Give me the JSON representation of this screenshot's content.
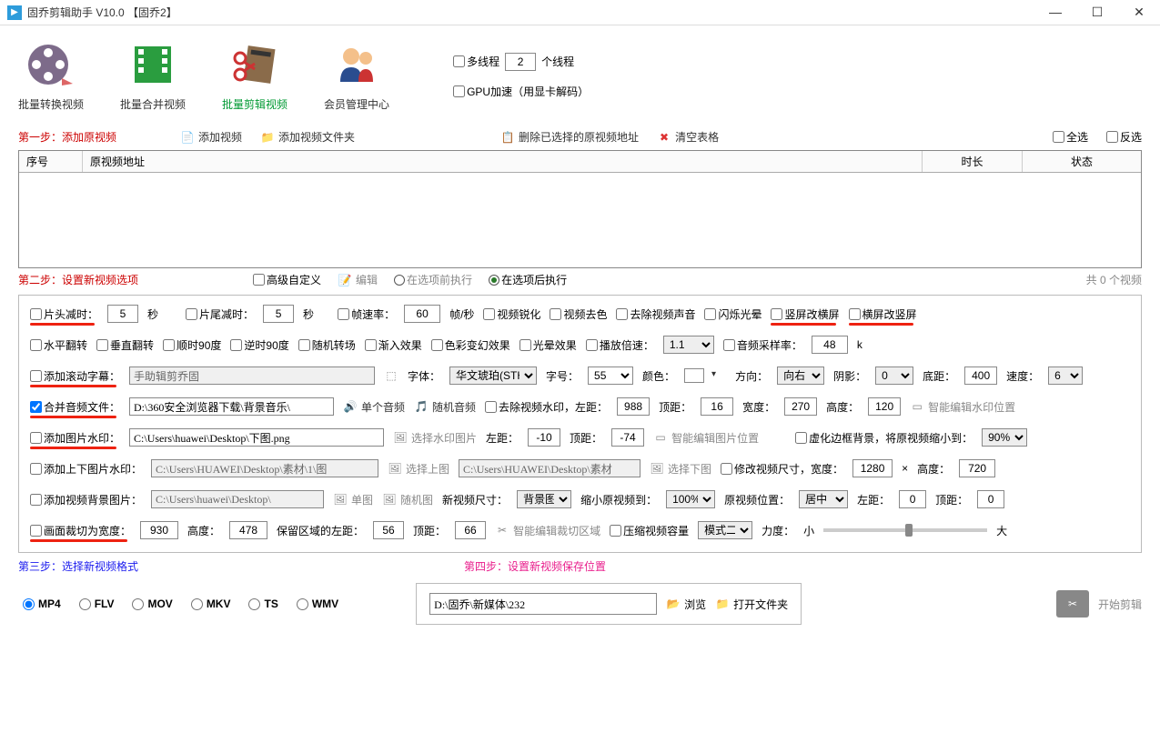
{
  "title": "固乔剪辑助手 V10.0  【固乔2】",
  "toolbar": {
    "t1": "批量转换视频",
    "t2": "批量合并视频",
    "t3": "批量剪辑视频",
    "t4": "会员管理中心",
    "multithread": "多线程",
    "threads": "2",
    "threads_unit": "个线程",
    "gpu": "GPU加速（用显卡解码）"
  },
  "step1": {
    "label": "第一步：添加原视频",
    "add_video": "添加视频",
    "add_folder": "添加视频文件夹",
    "delete_sel": "删除已选择的原视频地址",
    "clear": "清空表格",
    "select_all": "全选",
    "invert": "反选"
  },
  "table": {
    "c1": "序号",
    "c2": "原视频地址",
    "c3": "时长",
    "c4": "状态"
  },
  "step2": {
    "label": "第二步：设置新视频选项",
    "advanced": "高级自定义",
    "edit": "编辑",
    "before": "在选项前执行",
    "after": "在选项后执行",
    "count": "共  0  个视频"
  },
  "opts": {
    "head_trim": "片头减时：",
    "head_val": "5",
    "sec": "秒",
    "tail_trim": "片尾减时：",
    "tail_val": "5",
    "fps": "帧速率：",
    "fps_val": "60",
    "fps_unit": "帧/秒",
    "sharpen": "视频锐化",
    "decolor": "视频去色",
    "mute": "去除视频声音",
    "flash": "闪烁光晕",
    "v2h": "竖屏改横屏",
    "h2v": "横屏改竖屏",
    "hflip": "水平翻转",
    "vflip": "垂直翻转",
    "cw90": "顺时90度",
    "ccw90": "逆时90度",
    "rand_trans": "随机转场",
    "fadein": "渐入效果",
    "color_shift": "色彩变幻效果",
    "halo": "光晕效果",
    "speed": "播放倍速：",
    "speed_val": "1.1",
    "sample": "音频采样率：",
    "sample_val": "48",
    "k": "k",
    "subtitle": "添加滚动字幕：",
    "subtitle_val": "手助辑剪乔固",
    "font": "字体：",
    "font_val": "华文琥珀(STH",
    "size": "字号：",
    "size_val": "55",
    "color": "颜色：",
    "dir": "方向：",
    "dir_val": "向右",
    "shadow": "阴影：",
    "shadow_val": "0",
    "bottom": "底距：",
    "bottom_val": "400",
    "speed2": "速度：",
    "speed2_val": "6",
    "merge_audio": "合并音频文件：",
    "audio_path": "D:\\360安全浏览器下载\\背景音乐\\",
    "single_audio": "单个音频",
    "rand_audio": "随机音频",
    "rm_wm": "去除视频水印，左距：",
    "rm_l": "988",
    "top": "顶距：",
    "rm_t": "16",
    "width": "宽度：",
    "rm_w": "270",
    "height": "高度：",
    "rm_h": "120",
    "smart_wm": "智能编辑水印位置",
    "img_wm": "添加图片水印：",
    "img_path": "C:\\Users\\huawei\\Desktop\\下图.png",
    "sel_img": "选择水印图片",
    "left": "左距：",
    "img_l": "-10",
    "img_t": "-74",
    "smart_img": "智能编辑图片位置",
    "blur_edge": "虚化边框背景，将原视频缩小到：",
    "blur_val": "90%",
    "ud_wm": "添加上下图片水印：",
    "ud_path1": "C:\\Users\\HUAWEI\\Desktop\\素材\\1\\图",
    "sel_top": "选择上图",
    "ud_path2": "C:\\Users\\HUAWEI\\Desktop\\素材",
    "sel_bot": "选择下图",
    "mod_size": "修改视频尺寸，宽度：",
    "mod_w": "1280",
    "x": "×",
    "mod_h": "720",
    "bg_img": "添加视频背景图片：",
    "bg_path": "C:\\Users\\huawei\\Desktop\\",
    "single_img": "单图",
    "rand_img": "随机图",
    "new_size": "新视频尺寸：",
    "bg_sel": "背景图",
    "shrink": "缩小原视频到：",
    "shrink_val": "100%",
    "pos": "原视频位置：",
    "pos_val": "居中",
    "pos_l": "0",
    "pos_t": "0",
    "crop": "画面裁切为宽度：",
    "crop_w": "930",
    "crop_h_lbl": "高度：",
    "crop_h": "478",
    "keep_l_lbl": "保留区域的左距：",
    "keep_l": "56",
    "keep_t": "66",
    "smart_crop": "智能编辑裁切区域",
    "compress": "压缩视频容量",
    "mode": "模式二",
    "strength": "力度：",
    "small": "小",
    "large": "大"
  },
  "step3": "第三步：选择新视频格式",
  "step4": "第四步：设置新视频保存位置",
  "formats": {
    "mp4": "MP4",
    "flv": "FLV",
    "mov": "MOV",
    "mkv": "MKV",
    "ts": "TS",
    "wmv": "WMV"
  },
  "save": {
    "path": "D:\\固乔\\新媒体\\232",
    "browse": "浏览",
    "open": "打开文件夹",
    "start": "开始剪辑"
  }
}
